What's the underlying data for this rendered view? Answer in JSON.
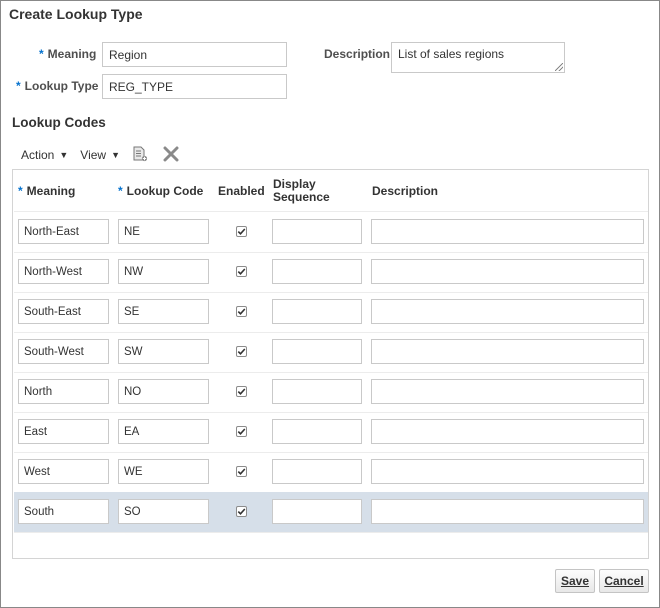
{
  "dialog": {
    "title": "Create Lookup Type"
  },
  "form": {
    "required_marker": "*",
    "meaning_label": "Meaning",
    "meaning_value": "Region",
    "lookup_type_label": "Lookup Type",
    "lookup_type_value": "REG_TYPE",
    "description_label": "Description",
    "description_value": "List of sales regions"
  },
  "lookup_codes": {
    "title": "Lookup Codes",
    "toolbar": {
      "action_label": "Action",
      "view_label": "View",
      "icons": [
        "create-icon",
        "delete-icon"
      ]
    },
    "columns": {
      "meaning": "Meaning",
      "lookup_code": "Lookup Code",
      "enabled": "Enabled",
      "display_sequence_1": "Display",
      "display_sequence_2": "Sequence",
      "description": "Description"
    },
    "rows": [
      {
        "meaning": "North-East",
        "code": "NE",
        "enabled": true,
        "sequence": "",
        "description": ""
      },
      {
        "meaning": "North-West",
        "code": "NW",
        "enabled": true,
        "sequence": "",
        "description": ""
      },
      {
        "meaning": "South-East",
        "code": "SE",
        "enabled": true,
        "sequence": "",
        "description": ""
      },
      {
        "meaning": "South-West",
        "code": "SW",
        "enabled": true,
        "sequence": "",
        "description": ""
      },
      {
        "meaning": "North",
        "code": "NO",
        "enabled": true,
        "sequence": "",
        "description": ""
      },
      {
        "meaning": "East",
        "code": "EA",
        "enabled": true,
        "sequence": "",
        "description": ""
      },
      {
        "meaning": "West",
        "code": "WE",
        "enabled": true,
        "sequence": "",
        "description": ""
      },
      {
        "meaning": "South",
        "code": "SO",
        "enabled": true,
        "sequence": "",
        "description": "",
        "selected": true
      }
    ]
  },
  "footer": {
    "save_label": "Save",
    "cancel_label": "Cancel"
  }
}
